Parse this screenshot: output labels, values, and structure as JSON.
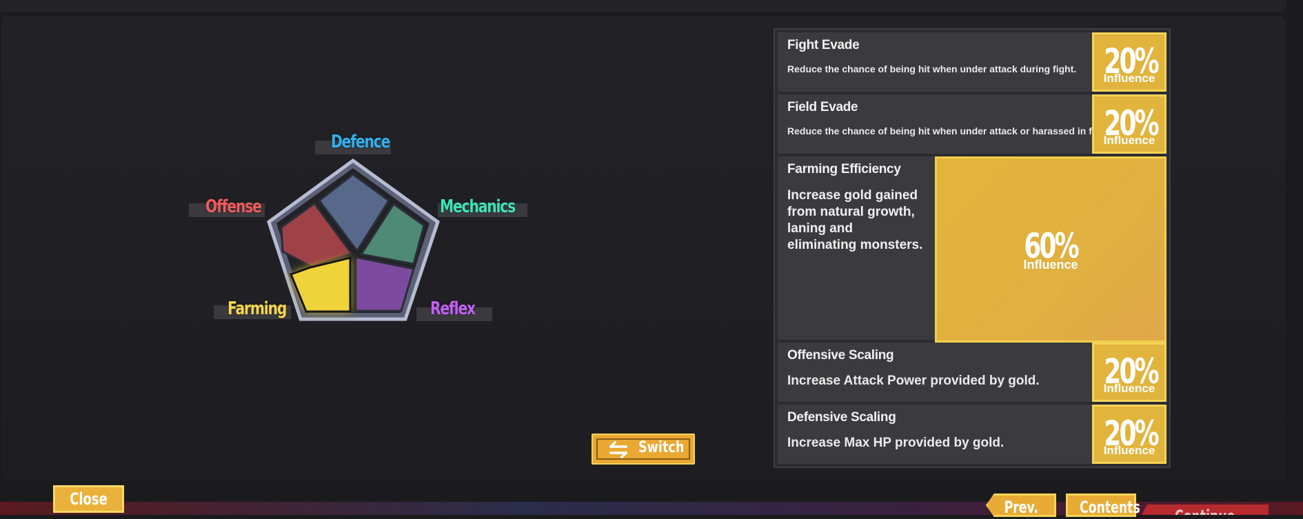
{
  "radar": {
    "stats": [
      {
        "name": "Defence",
        "color": "#2fb1f0"
      },
      {
        "name": "Mechanics",
        "color": "#3ee3b6"
      },
      {
        "name": "Reflex",
        "color": "#c261f5"
      },
      {
        "name": "Farming",
        "color": "#f7d74a"
      },
      {
        "name": "Offense",
        "color": "#ee5a5e"
      }
    ],
    "selected": "Farming"
  },
  "influence_table": {
    "rows": [
      {
        "title": "Fight Evade",
        "desc": "Reduce the chance of being hit when under attack during fight.",
        "percent": "20%",
        "label": "Influence"
      },
      {
        "title": "Field Evade",
        "desc": "Reduce the chance of being hit when under attack or harassed in field.",
        "percent": "20%",
        "label": "Influence"
      },
      {
        "title": "Farming Efficiency",
        "desc": "Increase gold gained from natural growth, laning and eliminating monsters.",
        "percent": "60%",
        "label": "Influence"
      },
      {
        "title": "Offensive Scaling",
        "desc": "Increase Attack Power provided by gold.",
        "percent": "20%",
        "label": "Influence"
      },
      {
        "title": "Defensive Scaling",
        "desc": "Increase Max HP provided by gold.",
        "percent": "20%",
        "label": "Influence"
      }
    ]
  },
  "buttons": {
    "switch": "Switch",
    "close": "Close",
    "prev": "Prev.",
    "contents": "Contents",
    "continue": "Continue"
  },
  "colors": {
    "accent": "#e9b13a",
    "panel": "#222226"
  }
}
